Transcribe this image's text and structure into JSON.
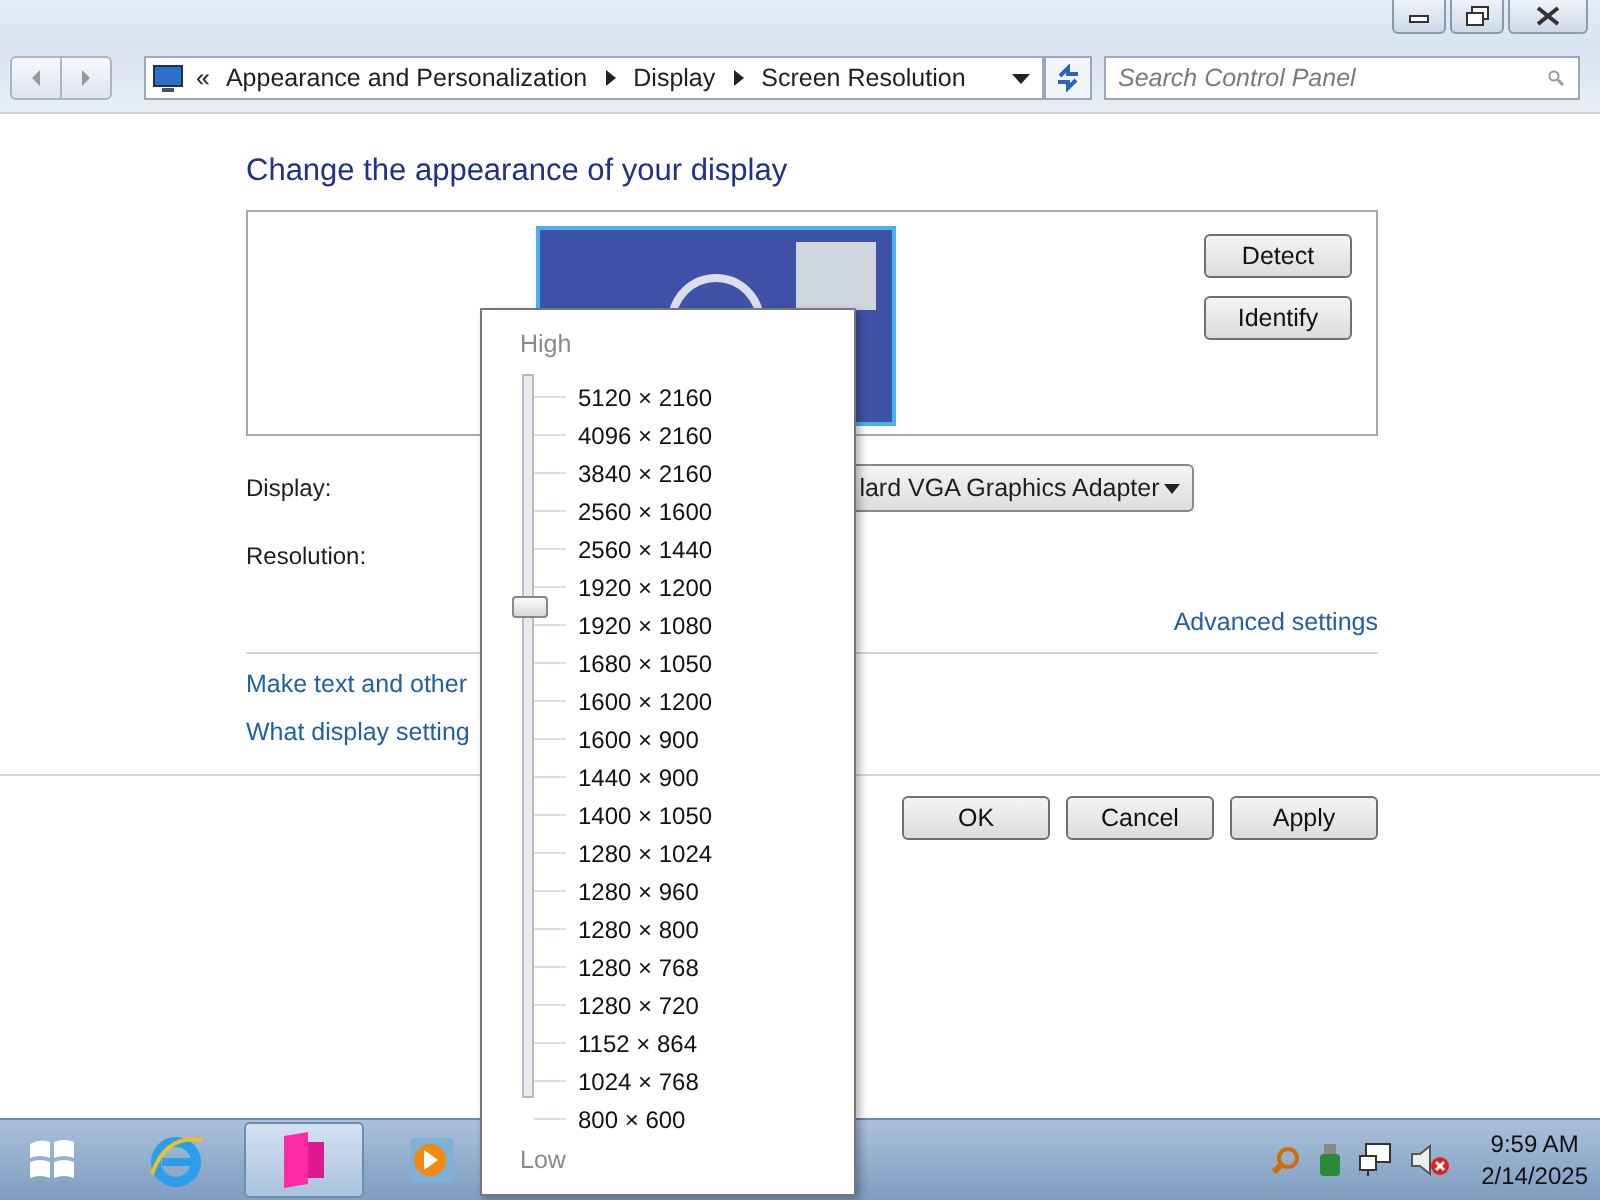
{
  "address_bar": {
    "overflow": "«",
    "crumbs": [
      "Appearance and Personalization",
      "Display",
      "Screen Resolution"
    ]
  },
  "search": {
    "placeholder": "Search Control Panel"
  },
  "heading": "Change the appearance of your display",
  "preview_buttons": [
    "Detect",
    "Identify"
  ],
  "display": {
    "label": "Display:",
    "value": "lard VGA Graphics Adapter"
  },
  "resolution": {
    "label": "Resolution:"
  },
  "advanced_link": "Advanced settings",
  "links": [
    "Make text and other",
    "What display setting"
  ],
  "buttons": [
    "OK",
    "Cancel",
    "Apply"
  ],
  "resolution_popup": {
    "high": "High",
    "low": "Low",
    "level": 0.68,
    "options": [
      "5120 × 2160",
      "4096 × 2160",
      "3840 × 2160",
      "2560 × 1600",
      "2560 × 1440",
      "1920 × 1200",
      "1920 × 1080",
      "1680 × 1050",
      "1600 × 1200",
      "1600 × 900",
      "1440 × 900",
      "1400 × 1050",
      "1280 × 1024",
      "1280 × 960",
      "1280 × 800",
      "1280 × 768",
      "1280 × 720",
      "1152 × 864",
      "1024 × 768",
      "800 × 600"
    ]
  },
  "taskbar": {
    "apps": [
      {
        "kind": "browser",
        "selected": false
      },
      {
        "kind": "folder",
        "selected": true
      },
      {
        "kind": "media",
        "selected": false
      }
    ],
    "clock": {
      "time": "9:59 AM",
      "date": "2/14/2025"
    }
  }
}
